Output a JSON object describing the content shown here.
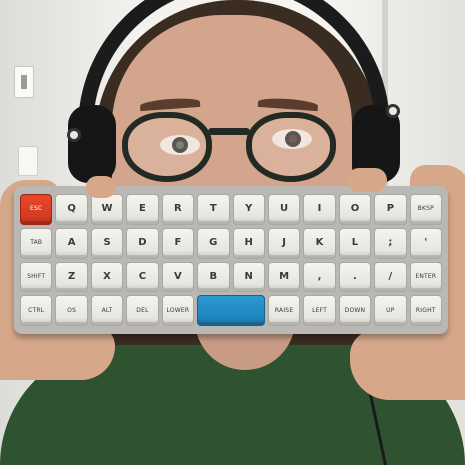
{
  "keyboard": {
    "rows": [
      [
        "ESC",
        "Q",
        "W",
        "E",
        "R",
        "T",
        "Y",
        "U",
        "I",
        "O",
        "P",
        "BKSP"
      ],
      [
        "TAB",
        "A",
        "S",
        "D",
        "F",
        "G",
        "H",
        "J",
        "K",
        "L",
        ";",
        "'"
      ],
      [
        "SHIFT",
        "Z",
        "X",
        "C",
        "V",
        "B",
        "N",
        "M",
        ",",
        ".",
        "/",
        "ENTER"
      ],
      [
        "CTRL",
        "OS",
        "ALT",
        "DEL",
        "LOWER",
        "",
        "RAISE",
        "LEFT",
        "DOWN",
        "UP",
        "RIGHT"
      ]
    ],
    "accent_key_color": "#d53a22",
    "spacebar_color": "#1f84bd",
    "keycap_color": "#ecebe6"
  },
  "colors": {
    "shirt": "#2f5230",
    "hair": "#3b2c22",
    "headphones": "#1b1b1c"
  }
}
